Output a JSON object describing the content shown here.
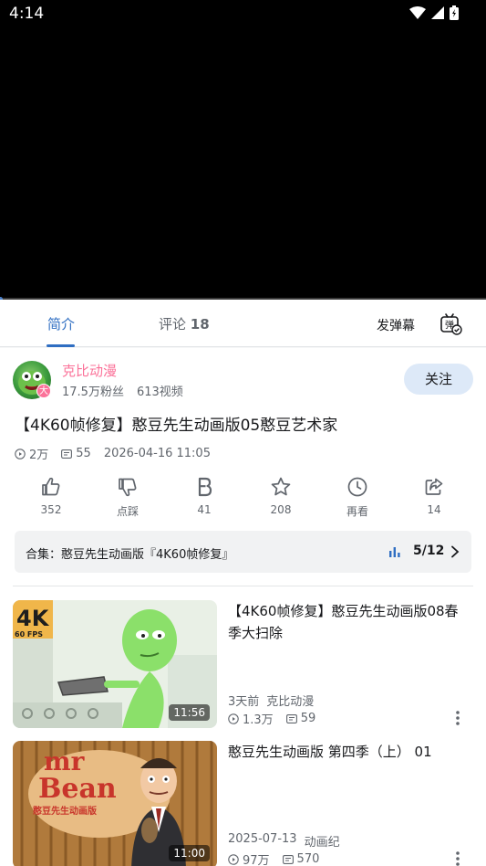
{
  "status": {
    "time": "4:14"
  },
  "tabs": {
    "intro": "简介",
    "comments": "评论",
    "comments_count": "18",
    "send_danmaku": "发弹幕",
    "danmaku_icon_text": "弹"
  },
  "uploader": {
    "name": "克比动漫",
    "fans": "17.5万粉丝",
    "videos": "613视频",
    "badge": "大",
    "follow": "关注"
  },
  "video": {
    "title": "【4K60帧修复】憨豆先生动画版05憨豆艺术家",
    "views": "2万",
    "danmaku": "55",
    "date": "2026-04-16 11:05"
  },
  "actions": [
    {
      "icon": "thumbs-up-icon",
      "label": "352"
    },
    {
      "icon": "thumbs-down-icon",
      "label": "点踩"
    },
    {
      "icon": "coin-icon",
      "label": "41"
    },
    {
      "icon": "star-icon",
      "label": "208"
    },
    {
      "icon": "clock-icon",
      "label": "再看"
    },
    {
      "icon": "share-icon",
      "label": "14"
    }
  ],
  "collection": {
    "label": "合集：憨豆先生动画版『4K60帧修复』",
    "progress": "5/12"
  },
  "recommendations": [
    {
      "title": "【4K60帧修复】憨豆先生动画版08春季大扫除",
      "duration": "11:56",
      "time_ago": "3天前",
      "up": "克比动漫",
      "views": "1.3万",
      "danmaku": "59",
      "thumb_badge": "4K",
      "thumb_sub": "60 FPS"
    },
    {
      "title": "憨豆先生动画版 第四季（上） 01",
      "duration": "11:00",
      "time_ago": "2025-07-13",
      "up": "动画纪",
      "views": "97万",
      "danmaku": "570",
      "thumb_logo_1": "mr",
      "thumb_logo_2": "Bean",
      "thumb_logo_3": "憨豆先生动画版"
    }
  ],
  "colors": {
    "accent_blue": "#2f6ec2",
    "pink": "#fb7299",
    "follow_bg": "#dde9f8",
    "muted": "#61666d"
  }
}
